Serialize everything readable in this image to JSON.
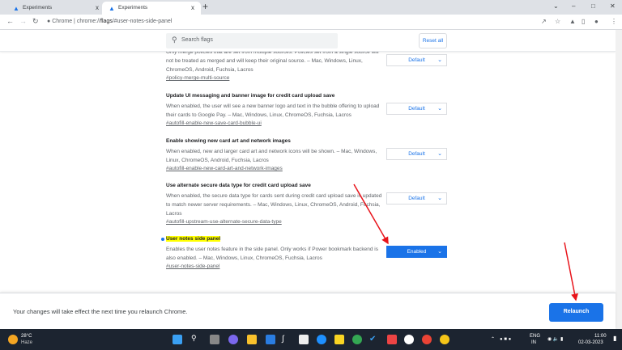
{
  "tabs": [
    {
      "label": "Experiments",
      "close": "x"
    },
    {
      "label": "Experiments",
      "close": "x",
      "active": true
    }
  ],
  "new_tab": "+",
  "address": {
    "site": "Chrome",
    "url_prefix": "chrome://",
    "url_bold": "flags",
    "url_rest": "/#user-notes-side-panel"
  },
  "header": {
    "search_placeholder": "Search flags",
    "reset_label": "Reset all"
  },
  "flags": [
    {
      "title": "",
      "description": "Only merge policies that are set from multiple sources. Policies set from a single source will not be treated as merged and will keep their original source. – Mac, Windows, Linux, ChromeOS, Android, Fuchsia, Lacros",
      "link": "#policy-merge-multi-source",
      "value": "Default"
    },
    {
      "title": "Update UI messaging and banner image for credit card upload save",
      "description": "When enabled, the user will see a new banner logo and text in the bubble offering to upload their cards to Google Pay. – Mac, Windows, Linux, ChromeOS, Fuchsia, Lacros",
      "link": "#autofill-enable-new-save-card-bubble-ui",
      "value": "Default"
    },
    {
      "title": "Enable showing new card art and network images",
      "description": "When enabled, new and larger card art and network icons will be shown. – Mac, Windows, Linux, ChromeOS, Android, Fuchsia, Lacros",
      "link": "#autofill-enable-new-card-art-and-network-images",
      "value": "Default"
    },
    {
      "title": "Use alternate secure data type for credit card upload save",
      "description": "When enabled, the secure data type for cards sent during credit card upload save is updated to match newer server requirements. – Mac, Windows, Linux, ChromeOS, Android, Fuchsia, Lacros",
      "link": "#autofill-upstream-use-alternate-secure-data-type",
      "value": "Default"
    },
    {
      "title": "User notes side panel",
      "description": "Enables the user notes feature in the side panel. Only works if Power bookmark backend is also enabled. – Mac, Windows, Linux, ChromeOS, Fuchsia, Lacros",
      "link": "#user-notes-side-panel",
      "value": "Enabled",
      "highlighted": true
    }
  ],
  "bottom": {
    "message": "Your changes will take effect the next time you relaunch Chrome.",
    "relaunch_label": "Relaunch"
  },
  "taskbar": {
    "weather_temp": "28°C",
    "weather_desc": "Haze",
    "lang1": "ENG",
    "lang2": "IN",
    "time": "11:00",
    "date": "02-03-2023"
  },
  "colors": {
    "accent": "#1a73e8",
    "highlight": "#ffff00",
    "annotation_arrow": "#e8141b"
  }
}
